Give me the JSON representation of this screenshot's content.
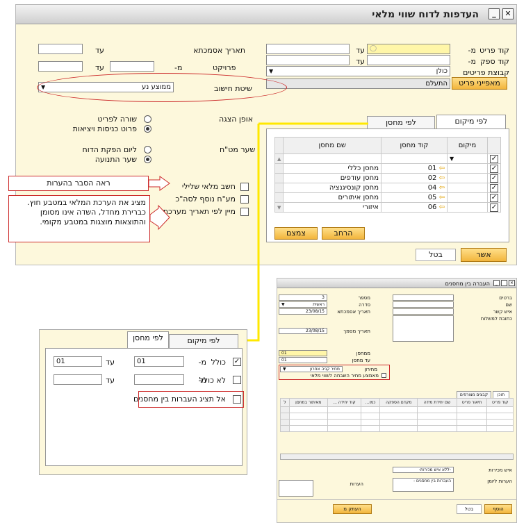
{
  "main": {
    "title": "העדפות לדוח שווי מלאי",
    "item_code_label": "קוד פריט",
    "vendor_code_label": "קוד ספק",
    "item_group_label": "קבוצת פריטים",
    "from": "מ-",
    "to": "עד",
    "item_group_value": "כולן",
    "item_props_button": "מאפייני פריט",
    "ignore_value": "התעלם",
    "posting_date_label": "תאריך אסמכתא",
    "project_label": "פרויקט",
    "calc_method_label": "שיטת חישוב",
    "calc_method_value": "ממוצע נע",
    "display_mode_label": "אופן הצגה",
    "radio_item_row": "שורה לפריט",
    "radio_item_detail": "פרוט כניסות ויציאות",
    "currency_rate_label": "שער מט\"ח",
    "radio_report_date": "ליום הפקת הדוח",
    "radio_transaction_rate": "שער התנועה",
    "chk_negative": "חשב מלאי שלילי",
    "chk_vat": "מע\"ח נוסף לסה\"כ",
    "chk_sort_date": "מיין לפי תאריך מערכת",
    "tab_by_location": "לפי מיקום",
    "tab_by_warehouse": "לפי מחסן",
    "grid_headers": [
      "מיקום",
      "קוד מחסן",
      "שם מחסן"
    ],
    "grid_rows": [
      {
        "code": "01",
        "name": "מחסן כללי"
      },
      {
        "code": "02",
        "name": "מחסן עודפים"
      },
      {
        "code": "04",
        "name": "מחסן קונסיגנציה"
      },
      {
        "code": "05",
        "name": "מחסן איתורים"
      },
      {
        "code": "06",
        "name": "איזורי"
      }
    ],
    "expand_button": "הרחב",
    "collapse_button": "צמצם",
    "ok_button": "אשר",
    "cancel_button": "בטל"
  },
  "callouts": {
    "notes": "ראה הסבר בהערות",
    "foreign_currency": "מציג את הערכת המלאי במטבע חוץ. כברירת מחדל, השדה אינו מסומן והתוצאות מוצגות במטבע מקומי."
  },
  "zoom": {
    "tab_by_location": "לפי מיקום",
    "tab_by_warehouse": "לפי מחסן",
    "include_label": "כולל",
    "exclude_label": "לא כולל",
    "from": "מ-",
    "to": "עד",
    "include_from": "01",
    "include_to": "01",
    "hide_transfers": "אל תציג העברות בין מחסנים"
  },
  "transfer": {
    "title": "העברה בין מחסנים",
    "customer_label": "ברטים",
    "name_label": "שם",
    "contact_label": "איש קשר",
    "ship_to_label": "כתובת למשלוח",
    "number_label": "מספר",
    "number_value": "3",
    "series_label": "סדרה",
    "series_value": "ראשית",
    "posting_date_label": "תאריך אסמכתא",
    "posting_date_value": "23/08/15",
    "doc_date_label": "תאריך מסמך",
    "doc_date_value": "23/08/15",
    "from_wh_label": "ממחסן",
    "from_wh_value": "01",
    "to_wh_label": "עד מחסן",
    "to_wh_value": "01",
    "price_list_label": "מחירון",
    "price_list_value": "מחיר קניה אחרון",
    "price_mode_label": "מאמצע מחיר השבחה לשווי מלאי",
    "tab_content": "תוכן",
    "tab_attachments": "קבצים מצורפים",
    "grid_headers": [
      "קוד פריט",
      "תיאור פריט",
      "שם יחידת מידה",
      "מקדם הספקה",
      "כמו...",
      "קוד יחידה ...",
      "מאיתור במחסן",
      "ל"
    ],
    "sales_employee_label": "איש מכירות",
    "sales_employee_value": "-ללא איש מכירות-",
    "journal_remark_label": "הערות ליומן",
    "journal_remark_value": "העברות בין מחסנים -",
    "remarks_label": "הערות",
    "add_button": "הוסף",
    "cancel_button": "בטל",
    "copy_to_button": "העתק מ"
  },
  "colors": {
    "dialog_bg": "#fdf8dc",
    "callout_red": "#cc2a2a",
    "connector_yellow": "#ffe800",
    "button_orange": "#f2b53c"
  }
}
